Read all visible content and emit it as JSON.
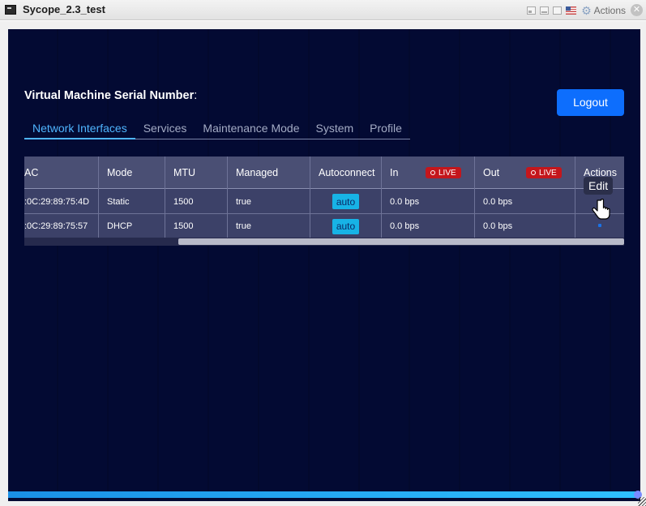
{
  "window": {
    "title": "Sycope_2.3_test",
    "actions_label": "Actions",
    "close_glyph": "✕",
    "icons": [
      "restore-icon",
      "minimize-icon",
      "maximize-icon",
      "us-flag-icon",
      "gear-icon",
      "close-icon"
    ]
  },
  "header": {
    "serial_label": "Virtual Machine Serial Number",
    "serial_colon": ":",
    "logout_label": "Logout"
  },
  "tabs": [
    {
      "label": "Network Interfaces",
      "active": true
    },
    {
      "label": "Services",
      "active": false
    },
    {
      "label": "Maintenance Mode",
      "active": false
    },
    {
      "label": "System",
      "active": false
    },
    {
      "label": "Profile",
      "active": false
    }
  ],
  "table": {
    "columns": {
      "mac": "AC",
      "mode": "Mode",
      "mtu": "MTU",
      "managed": "Managed",
      "autoconnect": "Autoconnect",
      "in": "In",
      "out": "Out",
      "actions": "Actions"
    },
    "live_label": "LIVE",
    "rows": [
      {
        "mac": ":0C:29:89:75:4D",
        "mode": "Static",
        "mtu": "1500",
        "managed": "true",
        "autoconnect": "auto",
        "in": "0.0 bps",
        "out": "0.0 bps"
      },
      {
        "mac": ":0C:29:89:75:57",
        "mode": "DHCP",
        "mtu": "1500",
        "managed": "true",
        "autoconnect": "auto",
        "in": "0.0 bps",
        "out": "0.0 bps"
      }
    ]
  },
  "tooltip": {
    "edit_label": "Edit"
  },
  "colors": {
    "background": "#030a33",
    "accent": "#0d6efd",
    "tab_active": "#4fb5ff",
    "live_badge": "#c4161c",
    "auto_badge": "#17b3e6"
  }
}
